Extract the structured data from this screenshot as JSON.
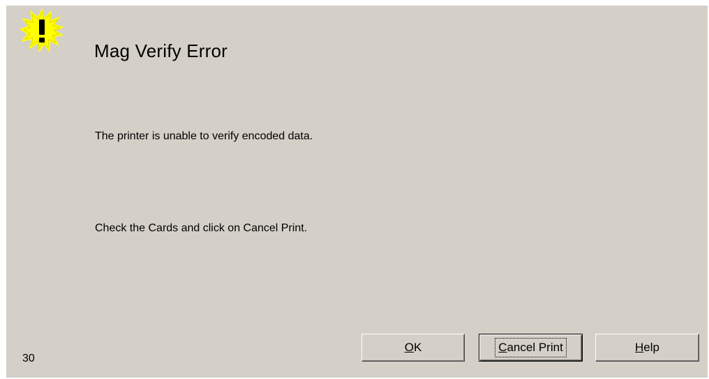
{
  "dialog": {
    "icon": "warning-starburst-icon",
    "title": "Mag Verify Error",
    "message_line1": "The printer is unable to verify encoded data.",
    "message_line2": "Check the Cards and click on Cancel Print.",
    "counter": "30"
  },
  "buttons": {
    "ok": {
      "accel": "O",
      "rest": "K"
    },
    "cancel_print": {
      "accel": "C",
      "rest": "ancel Print"
    },
    "help": {
      "accel": "H",
      "rest": "elp"
    }
  },
  "colors": {
    "dialog_bg": "#d4d0c8",
    "icon_yellow": "#ffff00"
  }
}
